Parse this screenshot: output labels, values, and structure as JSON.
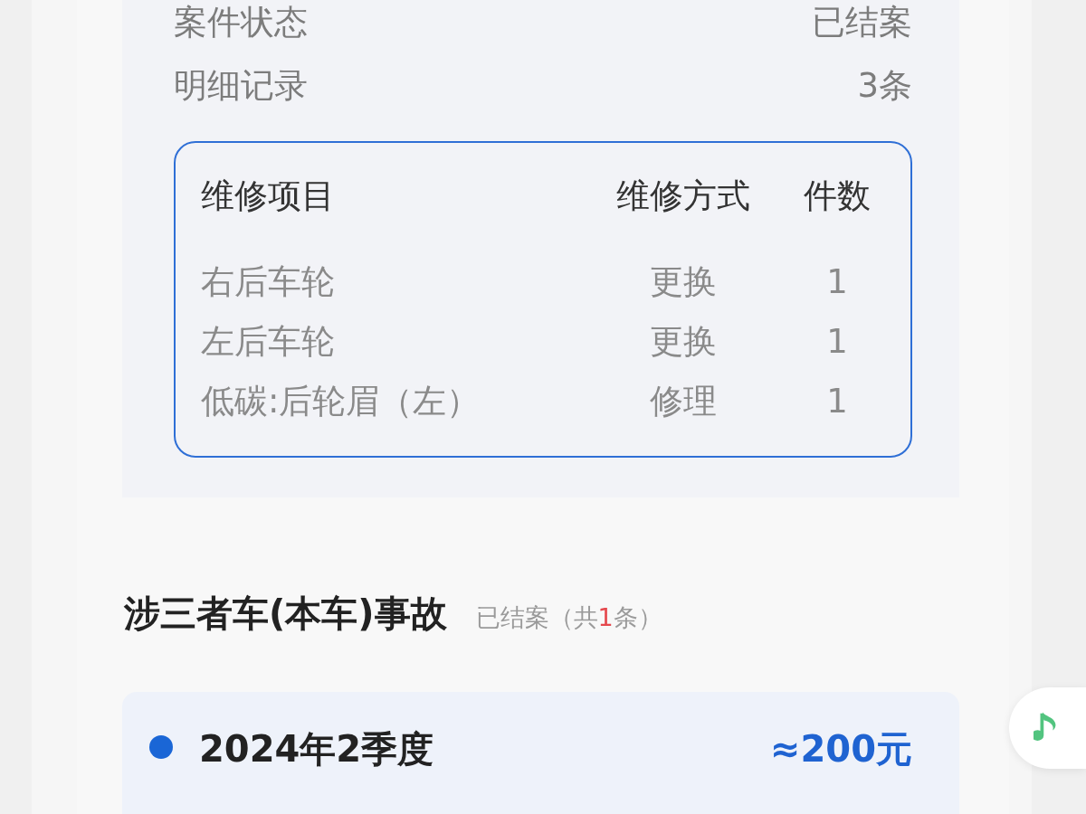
{
  "case_info": {
    "rows": [
      {
        "label": "案件状态",
        "value": "已结案"
      },
      {
        "label": "明细记录",
        "value": "3条"
      }
    ],
    "repair_table": {
      "columns": [
        "维修项目",
        "维修方式",
        "件数"
      ],
      "rows": [
        [
          "右后车轮",
          "更换",
          "1"
        ],
        [
          "左后车轮",
          "更换",
          "1"
        ],
        [
          "低碳:后轮眉（左）",
          "修理",
          "1"
        ]
      ]
    }
  },
  "section": {
    "title": "涉三者车(本车)事故",
    "status": "已结案",
    "count_prefix": "（共",
    "count": "1",
    "count_suffix": "条）"
  },
  "records": [
    {
      "period": "2024年2季度",
      "amount": "≈200元"
    }
  ]
}
